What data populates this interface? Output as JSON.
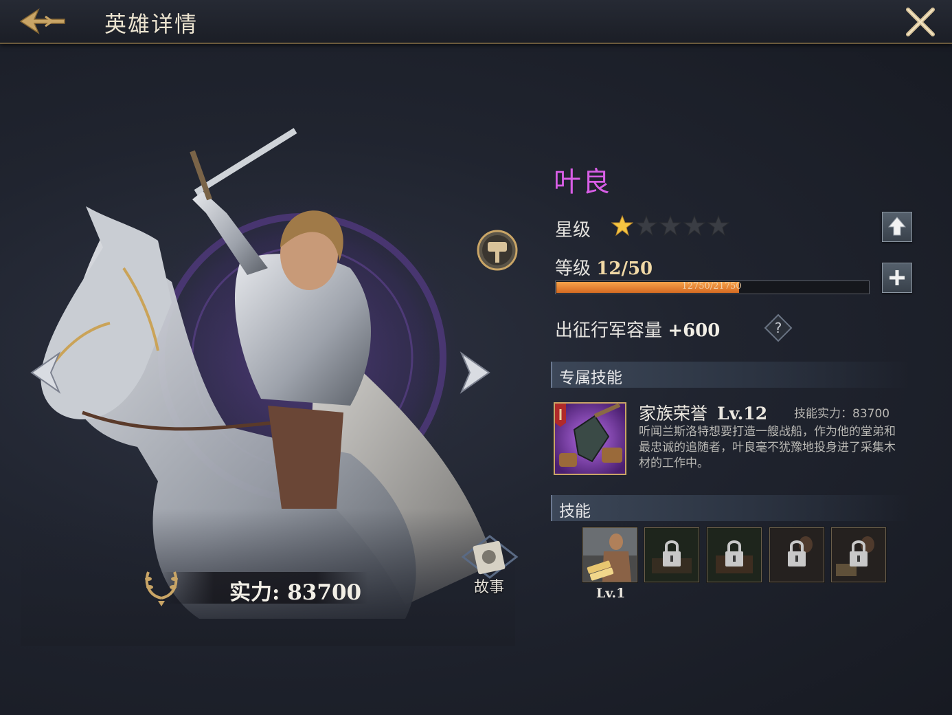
{
  "header": {
    "title": "英雄详情"
  },
  "hero": {
    "name": "叶良",
    "power_label": "实力: 83700",
    "story_label": "故事",
    "star_label": "星级",
    "stars_filled": 1,
    "stars_total": 5,
    "level_label": "等级",
    "level_value": "12/50",
    "xp_text": "12750/21750",
    "xp_current": 12750,
    "xp_max": 21750,
    "march_label": "出征行军容量",
    "march_value": "+600",
    "name_color": "#d85ee6"
  },
  "exclusive_skill": {
    "section_title": "专属技能",
    "name": "家族荣誉",
    "level": "Lv.12",
    "power": "技能实力：83700",
    "description": "听闻兰斯洛特想要打造一艘战船，作为他的堂弟和最忠诚的追随者，叶良毫不犹豫地投身进了采集木材的工作中。"
  },
  "skills": {
    "section_title": "技能",
    "slots": [
      {
        "icon": "lumber-worker-icon",
        "locked": false,
        "level": "Lv.1"
      },
      {
        "icon": "locked-skill-icon",
        "locked": true
      },
      {
        "icon": "locked-skill-icon",
        "locked": true
      },
      {
        "icon": "locked-skill-icon",
        "locked": true
      },
      {
        "icon": "locked-skill-icon",
        "locked": true
      }
    ]
  }
}
